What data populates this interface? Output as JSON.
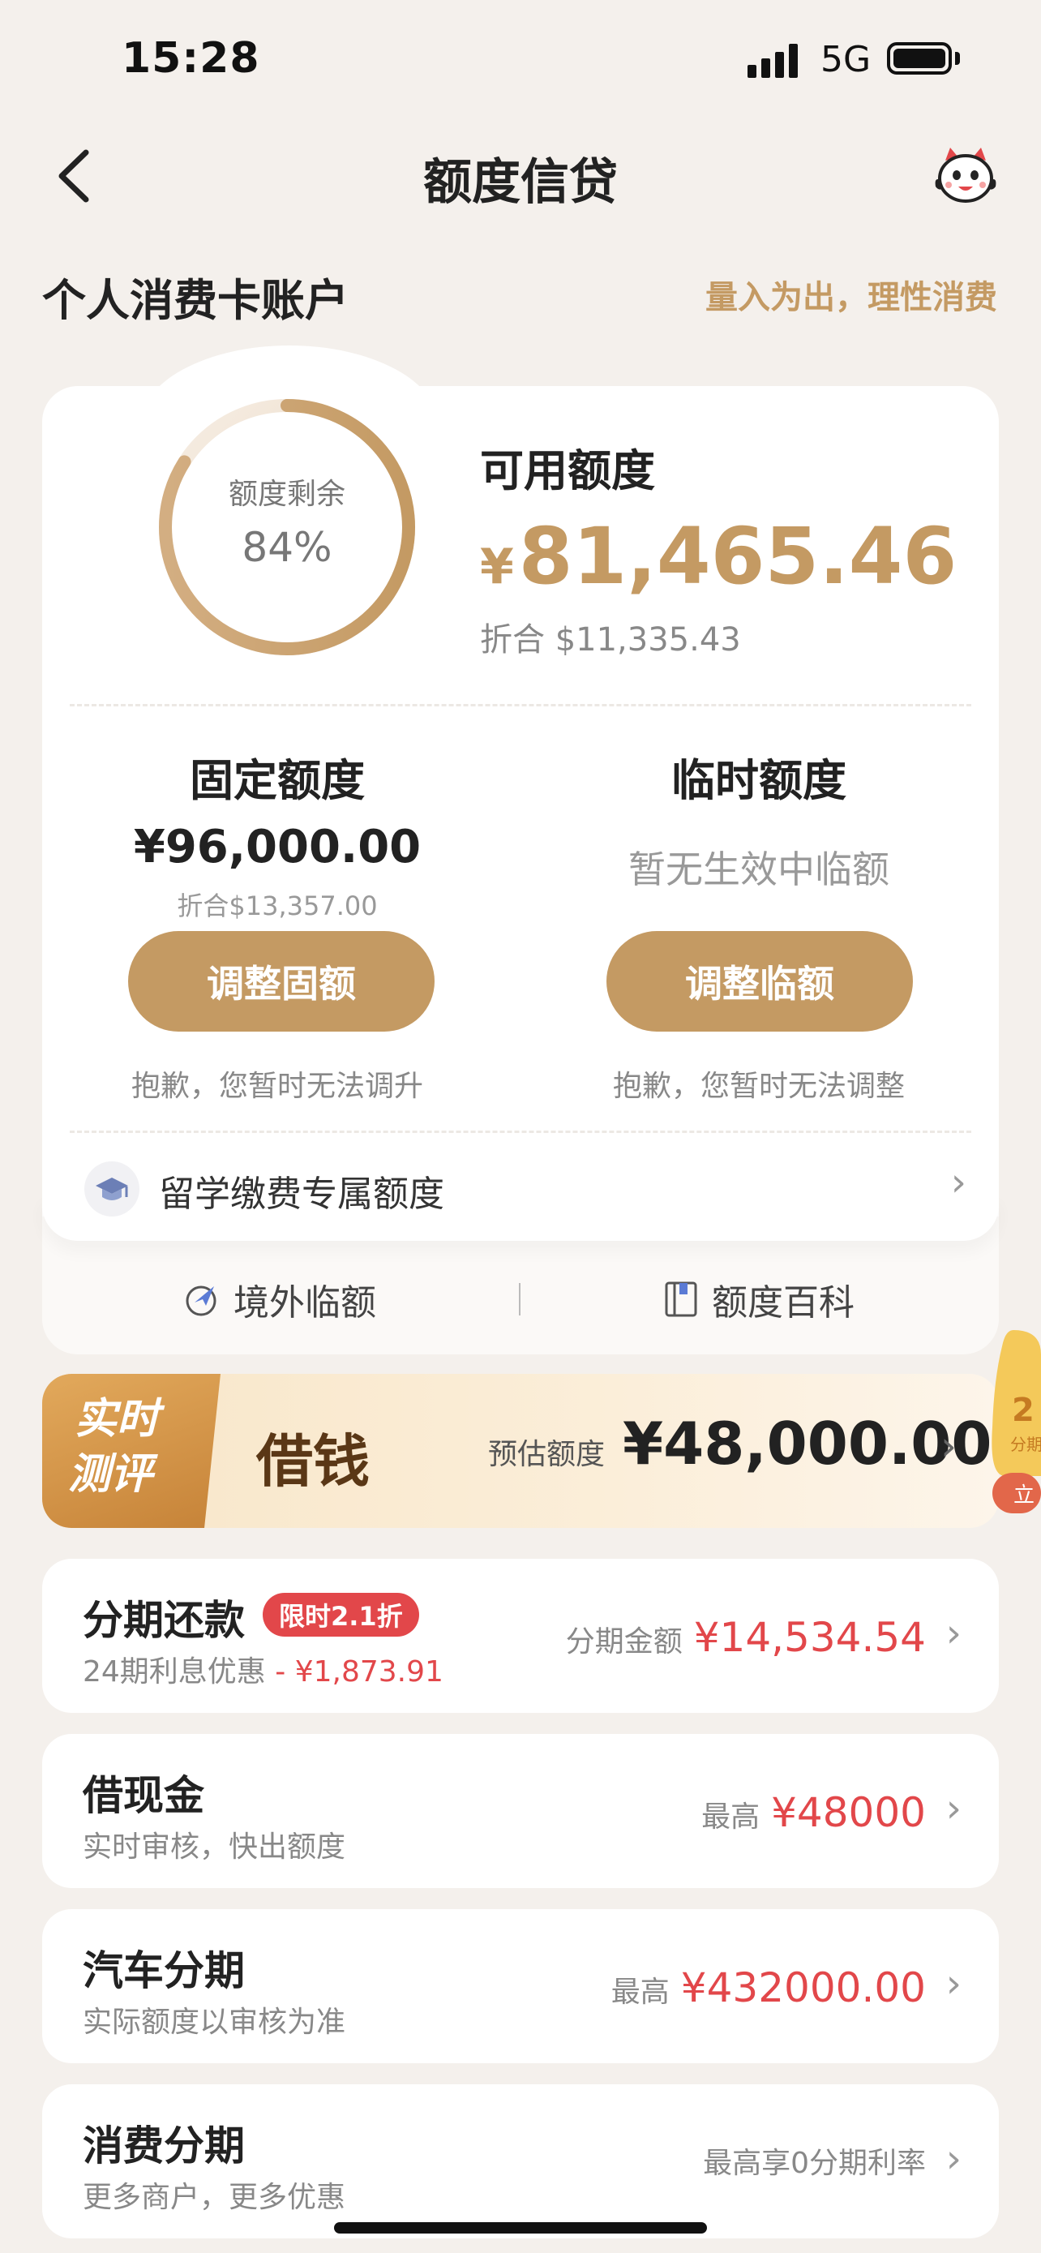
{
  "status_bar": {
    "time": "15:28",
    "network": "5G"
  },
  "nav": {
    "title": "额度信贷"
  },
  "account": {
    "title": "个人消费卡账户",
    "slogan": "量入为出，理性消费"
  },
  "summary": {
    "ring_label": "额度剩余",
    "remaining_percent": "84%",
    "remaining_fraction": 0.84,
    "available_label": "可用额度",
    "currency_symbol": "¥",
    "available_amount": "81,465.46",
    "available_usd": "折合 $11,335.43"
  },
  "fixed_limit": {
    "title": "固定额度",
    "amount": "¥96,000.00",
    "usd": "折合$13,357.00",
    "button": "调整固额",
    "note": "抱歉，您暂时无法调升"
  },
  "temp_limit": {
    "title": "临时额度",
    "status": "暂无生效中临额",
    "button": "调整临额",
    "note": "抱歉，您暂时无法调整"
  },
  "study_abroad": {
    "label": "留学缴费专属额度"
  },
  "bottom_links": {
    "overseas": "境外临额",
    "encyclopedia": "额度百科"
  },
  "promo": {
    "tag_line1": "实时",
    "tag_line2": "测评",
    "title": "借钱",
    "estimate_label": "预估额度",
    "estimate_amount": "¥48,000.00"
  },
  "list": [
    {
      "title": "分期还款",
      "badge": "限时2.1折",
      "sub": "24期利息优惠",
      "sub_highlight": "- ¥1,873.91",
      "right_label": "分期金额",
      "right_amount": "¥14,534.54"
    },
    {
      "title": "借现金",
      "sub": "实时审核，快出额度",
      "right_label": "最高",
      "right_amount": "¥48000"
    },
    {
      "title": "汽车分期",
      "sub": "实际额度以审核为准",
      "right_label": "最高",
      "right_amount": "¥432000.00"
    },
    {
      "title": "消费分期",
      "sub": "更多商户，更多优惠",
      "right_label": "最高享0分期利率",
      "right_amount": ""
    }
  ],
  "colors": {
    "gold": "#c49a63",
    "red": "#e2474a",
    "background": "#f4f0ec"
  }
}
